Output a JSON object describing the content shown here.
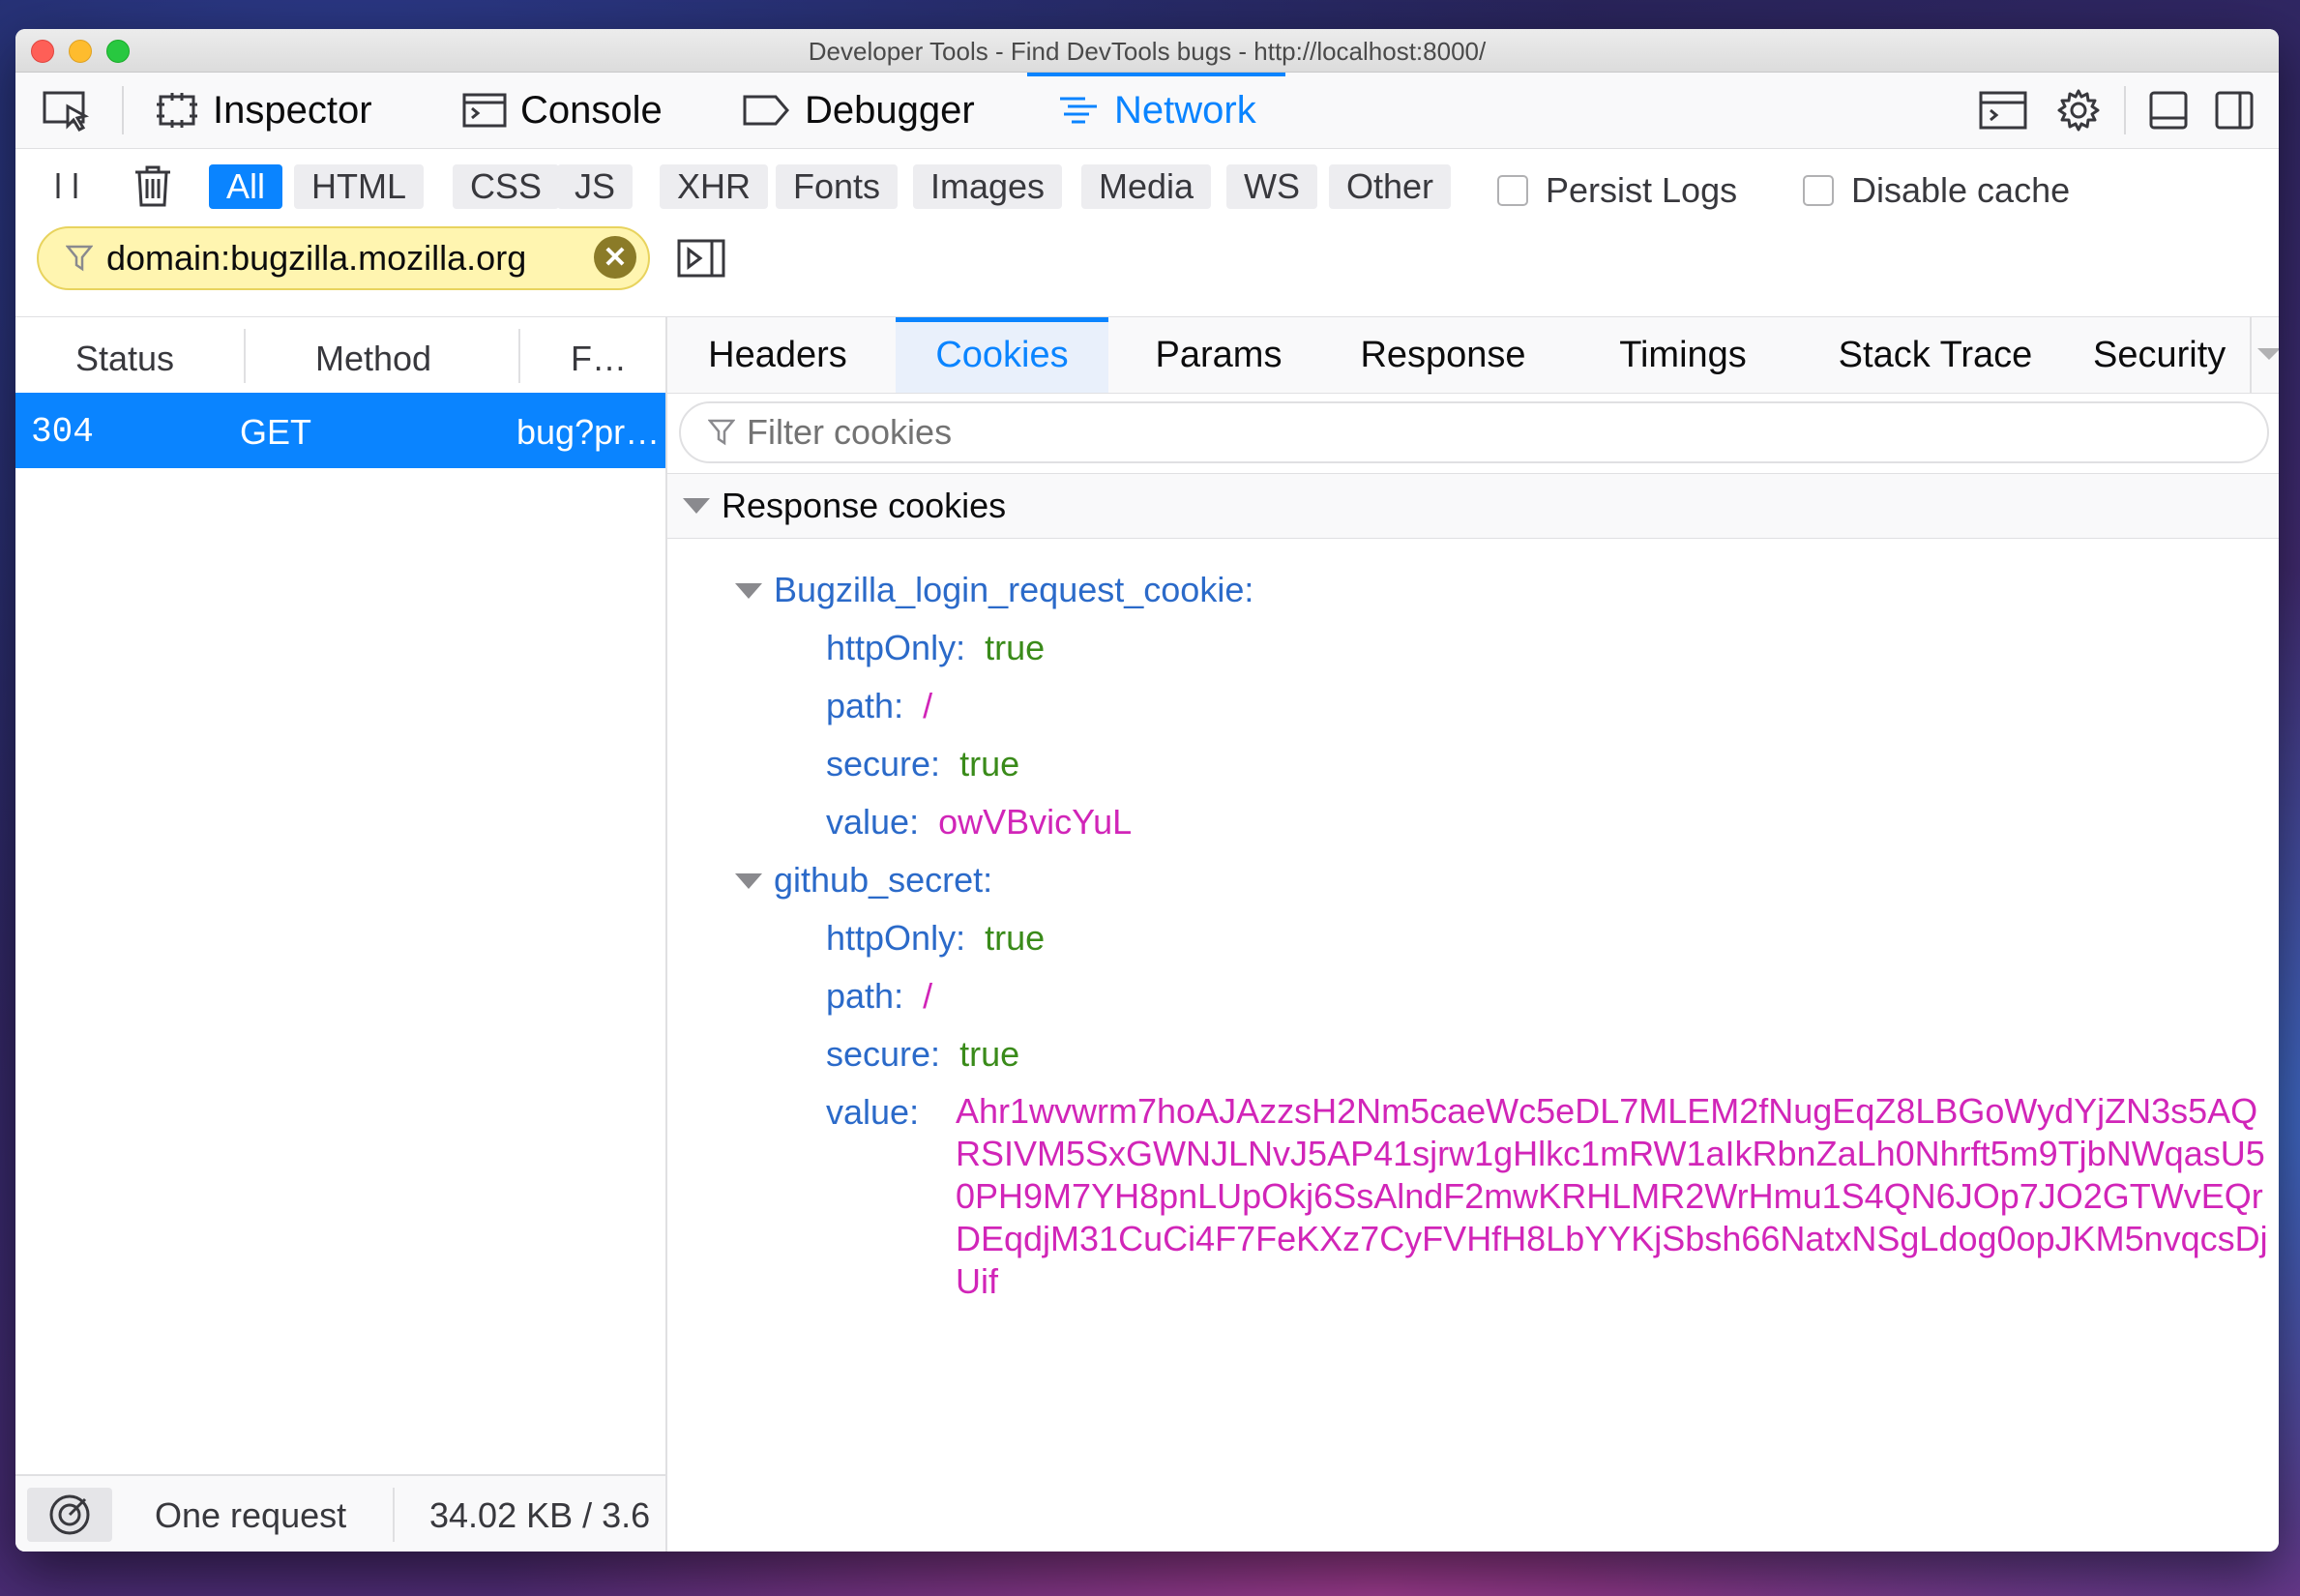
{
  "window": {
    "title": "Developer Tools - Find DevTools bugs - http://localhost:8000/"
  },
  "toolbox": {
    "tabs": [
      {
        "label": "Inspector",
        "icon": "inspector-icon"
      },
      {
        "label": "Console",
        "icon": "console-icon"
      },
      {
        "label": "Debugger",
        "icon": "debugger-icon"
      },
      {
        "label": "Network",
        "icon": "network-icon",
        "selected": true
      }
    ],
    "accent": "#0a84ff"
  },
  "filters": {
    "types": [
      "All",
      "HTML",
      "CSS",
      "JS",
      "XHR",
      "Fonts",
      "Images",
      "Media",
      "WS",
      "Other"
    ],
    "selected": "All",
    "persist_logs": "Persist Logs",
    "disable_cache": "Disable cache",
    "domain_filter": "domain:bugzilla.mozilla.org"
  },
  "requests": {
    "columns": [
      "Status",
      "Method",
      "F…"
    ],
    "rows": [
      {
        "status": "304",
        "method": "GET",
        "file": "bug?pr…"
      }
    ]
  },
  "statusbar": {
    "count": "One request",
    "size": "34.02 KB / 3.6"
  },
  "details": {
    "tabs": [
      "Headers",
      "Cookies",
      "Params",
      "Response",
      "Timings",
      "Stack Trace",
      "Security"
    ],
    "selected_tab": "Cookies",
    "filter_placeholder": "Filter cookies",
    "section_title": "Response cookies",
    "cookies": [
      {
        "name": "Bugzilla_login_request_cookie:",
        "httpOnly_key": "httpOnly:",
        "httpOnly": "true",
        "path_key": "path:",
        "path": "/",
        "secure_key": "secure:",
        "secure": "true",
        "value_key": "value:",
        "value": "owVBvicYuL"
      },
      {
        "name": "github_secret:",
        "httpOnly_key": "httpOnly:",
        "httpOnly": "true",
        "path_key": "path:",
        "path": "/",
        "secure_key": "secure:",
        "secure": "true",
        "value_key": "value:",
        "value": "Ahr1wvwrm7hoAJAzzsH2Nm5caeWc5eDL7MLEM2fNugEqZ8LBGoWydYjZN3s5AQRSIVM5SxGWNJLNvJ5AP41sjrw1gHlkc1mRW1aIkRbnZaLh0Nhrft5m9TjbNWqasU50PH9M7YH8pnLUpOkj6SsAlndF2mwKRHLMR2WrHmu1S4QN6JOp7JO2GTWvEQrDEqdjM31CuCi4F7FeKXz7CyFVHfH8LbYYKjSbsh66NatxNSgLdog0opJKM5nvqcsDjUif"
      }
    ]
  }
}
